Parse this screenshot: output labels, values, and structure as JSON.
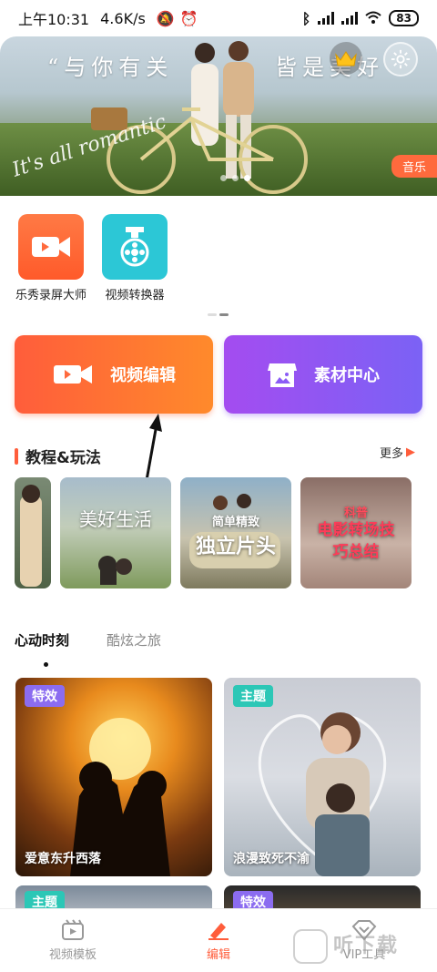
{
  "status_bar": {
    "time": "上午10:31",
    "speed": "4.6K/s",
    "battery": "83"
  },
  "banner": {
    "quote_left": "“与你有关",
    "quote_right": "皆是美好",
    "script_text": "It's all romantic",
    "tag": "音乐"
  },
  "apps": [
    {
      "label": "乐秀录屏大师",
      "color": "#ff6a3d"
    },
    {
      "label": "视频转换器",
      "color": "#2cc7d6"
    }
  ],
  "actions": {
    "edit_label": "视频编辑",
    "material_label": "素材中心"
  },
  "tutorials": {
    "title": "教程&玩法",
    "more": "更多",
    "items": [
      {
        "title": ""
      },
      {
        "title": "美好生活"
      },
      {
        "title": "独立片头",
        "subtitle": "简单精致"
      },
      {
        "title": "电影转场技巧总结",
        "subtitle": "科普"
      }
    ]
  },
  "tabs": {
    "active": "心动时刻",
    "inactive": "酷炫之旅"
  },
  "cards": [
    {
      "badge": "特效",
      "caption": "爱意东升西落",
      "badge_color": "#8b6cf0"
    },
    {
      "badge": "主题",
      "caption": "浪漫致死不渝",
      "badge_color": "#2cc7b6"
    }
  ],
  "cards_row2": [
    {
      "badge": "主题",
      "badge_color": "#2cc7b6"
    },
    {
      "badge": "特效",
      "badge_color": "#8b6cf0"
    }
  ],
  "bottom_nav": {
    "items": [
      {
        "label": "视频模板"
      },
      {
        "label": "编辑"
      },
      {
        "label": "VIP工具"
      }
    ]
  },
  "watermark": "听下载"
}
